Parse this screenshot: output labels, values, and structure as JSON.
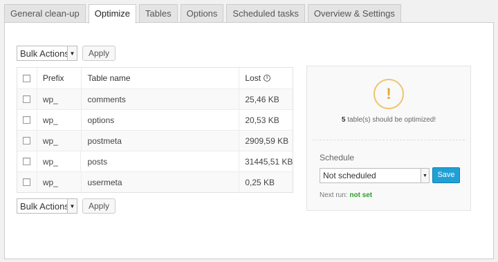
{
  "tabs": [
    {
      "label": "General clean-up",
      "active": false
    },
    {
      "label": "Optimize",
      "active": true
    },
    {
      "label": "Tables",
      "active": false
    },
    {
      "label": "Options",
      "active": false
    },
    {
      "label": "Scheduled tasks",
      "active": false
    },
    {
      "label": "Overview & Settings",
      "active": false
    }
  ],
  "bulk_top": {
    "select_value": "Bulk Actions",
    "apply_label": "Apply"
  },
  "bulk_bottom": {
    "select_value": "Bulk Actions",
    "apply_label": "Apply"
  },
  "table": {
    "headers": {
      "prefix": "Prefix",
      "name": "Table name",
      "lost": "Lost"
    },
    "rows": [
      {
        "prefix": "wp_",
        "name": "comments",
        "lost": "25,46 KB"
      },
      {
        "prefix": "wp_",
        "name": "options",
        "lost": "20,53 KB"
      },
      {
        "prefix": "wp_",
        "name": "postmeta",
        "lost": "2909,59 KB"
      },
      {
        "prefix": "wp_",
        "name": "posts",
        "lost": "31445,51 KB"
      },
      {
        "prefix": "wp_",
        "name": "usermeta",
        "lost": "0,25 KB"
      }
    ]
  },
  "side": {
    "warn_symbol": "!",
    "count": "5",
    "message": " table(s) should be optimized!",
    "schedule_label": "Schedule",
    "schedule_value": "Not scheduled",
    "save_label": "Save",
    "next_run_label": "Next run: ",
    "next_run_value": "not set"
  },
  "colors": {
    "accent": "#21a0d5",
    "warning": "#f0c36d",
    "ok": "#2e9c2e"
  }
}
